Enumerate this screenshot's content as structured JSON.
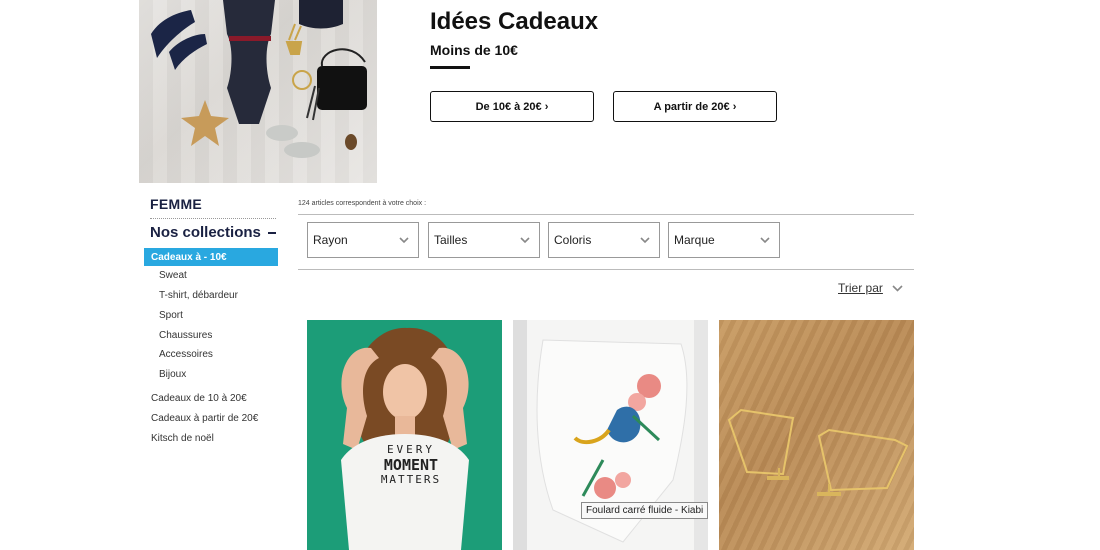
{
  "hero": {
    "title": "Idées Cadeaux",
    "subtitle": "Moins de 10€",
    "buttons": [
      {
        "label": "De 10€ à 20€ ›"
      },
      {
        "label": "A partir de 20€ ›"
      }
    ]
  },
  "sidebar": {
    "category": "FEMME",
    "collections_title": "Nos collections",
    "active_item": "Cadeaux à - 10€",
    "sub_items": [
      "Sweat",
      "T-shirt, débardeur",
      "Sport",
      "Chaussures",
      "Accessoires",
      "Bijoux"
    ],
    "main_items": [
      "Cadeaux de 10 à 20€",
      "Cadeaux à partir de 20€",
      "Kitsch de noël"
    ]
  },
  "results": {
    "count_text": "124 articles correspondent à votre choix :"
  },
  "filters": [
    "Rayon",
    "Tailles",
    "Coloris",
    "Marque"
  ],
  "sort": {
    "label": "Trier par"
  },
  "products": {
    "p1_shirt_text": [
      "EVERY",
      "MOMENT",
      "MATTERS"
    ]
  },
  "tooltip": {
    "text": "Foulard carré fluide - Kiabi"
  },
  "colors": {
    "accent": "#29a8e0",
    "navy": "#1a2142",
    "product_green": "#1c9d78"
  }
}
